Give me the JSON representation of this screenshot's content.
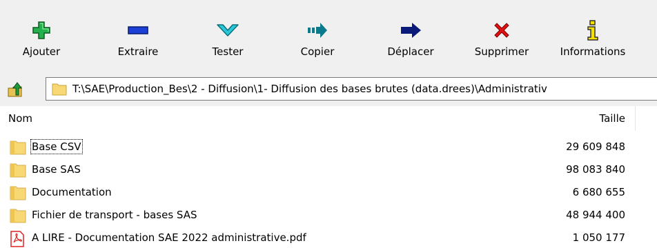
{
  "toolbar": {
    "buttons": [
      {
        "label": "Ajouter",
        "icon": "add-plus-icon"
      },
      {
        "label": "Extraire",
        "icon": "extract-minus-icon"
      },
      {
        "label": "Tester",
        "icon": "test-check-icon"
      },
      {
        "label": "Copier",
        "icon": "copy-arrow-icon"
      },
      {
        "label": "Déplacer",
        "icon": "move-arrow-icon"
      },
      {
        "label": "Supprimer",
        "icon": "delete-x-icon"
      },
      {
        "label": "Informations",
        "icon": "info-icon"
      }
    ]
  },
  "address": {
    "path": "T:\\SAE\\Production_Bes\\2 - Diffusion\\1- Diffusion des bases brutes (data.drees)\\Administrativ"
  },
  "list": {
    "columns": {
      "name": "Nom",
      "size": "Taille"
    },
    "rows": [
      {
        "name": "Base CSV",
        "size": "29 609 848",
        "type": "folder"
      },
      {
        "name": "Base SAS",
        "size": "98 083 840",
        "type": "folder"
      },
      {
        "name": "Documentation",
        "size": "6 680 655",
        "type": "folder"
      },
      {
        "name": "Fichier de transport - bases SAS",
        "size": "48 944 400",
        "type": "folder"
      },
      {
        "name": "A LIRE - Documentation SAE 2022 administrative.pdf",
        "size": "1 050 177",
        "type": "pdf"
      }
    ]
  },
  "colors": {
    "toolbar_bg": "#f0f0f0",
    "add_green": "#22b14c",
    "extract_blue": "#1c3fd6",
    "test_cyan": "#28c8d8",
    "copy_teal": "#0b7a8a",
    "move_navy": "#0a1a7a",
    "delete_red": "#e01010",
    "info_yellow": "#f5e000",
    "folder_yellow": "#f8d775"
  }
}
